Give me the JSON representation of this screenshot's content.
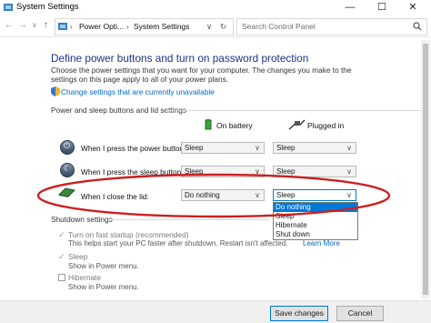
{
  "window": {
    "title": "System Settings",
    "minimize": "—",
    "maximize": "☐",
    "close": "✕"
  },
  "addressbar": {
    "crumbs": [
      "Power Opti...",
      "System Settings"
    ],
    "search_placeholder": "Search Control Panel"
  },
  "page": {
    "heading": "Define power buttons and turn on password protection",
    "intro": "Choose the power settings that you want for your computer. The changes you make to the settings on this page apply to all of your power plans.",
    "change_link": "Change settings that are currently unavailable"
  },
  "buttons_section": {
    "title": "Power and sleep buttons and lid settings",
    "col_battery": "On battery",
    "col_plugged": "Plugged in",
    "rows": [
      {
        "label": "When I press the power button:",
        "battery": "Sleep",
        "plugged": "Sleep"
      },
      {
        "label": "When I press the sleep button:",
        "battery": "Sleep",
        "plugged": "Sleep"
      },
      {
        "label": "When I close the lid:",
        "battery": "Do nothing",
        "plugged": "Sleep"
      }
    ],
    "open_dropdown_options": [
      "Do nothing",
      "Sleep",
      "Hibernate",
      "Shut down"
    ],
    "open_dropdown_selected": "Do nothing"
  },
  "shutdown_section": {
    "title": "Shutdown settings",
    "items": [
      {
        "label": "Turn on fast startup (recommended)",
        "sub": "This helps start your PC faster after shutdown. Restart isn't affected.",
        "sub_link": "Learn More",
        "checked": true
      },
      {
        "label": "Sleep",
        "sub": "Show in Power menu.",
        "checked": true
      },
      {
        "label": "Hibernate",
        "sub": "Show in Power menu.",
        "checked": false
      }
    ]
  },
  "footer": {
    "save": "Save changes",
    "cancel": "Cancel"
  },
  "colors": {
    "heading": "#1e3287",
    "link": "#0066cc",
    "annotation": "#cc1f1f",
    "selection": "#0078d7"
  }
}
